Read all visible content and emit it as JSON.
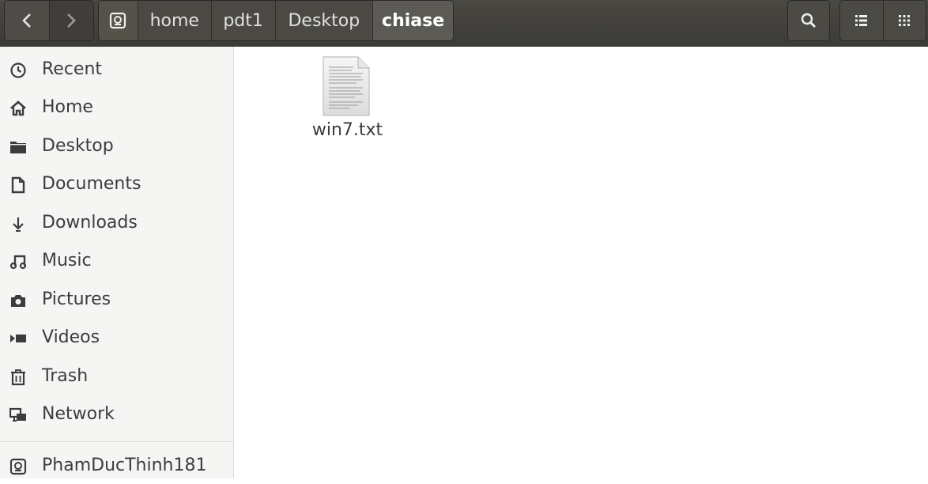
{
  "header": {
    "breadcrumbs": [
      "home",
      "pdt1",
      "Desktop",
      "chiase"
    ],
    "current": "chiase"
  },
  "sidebar": {
    "items": [
      {
        "label": "Recent",
        "icon": "clock-icon"
      },
      {
        "label": "Home",
        "icon": "home-icon"
      },
      {
        "label": "Desktop",
        "icon": "folder-icon"
      },
      {
        "label": "Documents",
        "icon": "document-icon"
      },
      {
        "label": "Downloads",
        "icon": "download-icon"
      },
      {
        "label": "Music",
        "icon": "music-icon"
      },
      {
        "label": "Pictures",
        "icon": "camera-icon"
      },
      {
        "label": "Videos",
        "icon": "video-icon"
      },
      {
        "label": "Trash",
        "icon": "trash-icon"
      },
      {
        "label": "Network",
        "icon": "network-icon"
      }
    ],
    "drives": [
      {
        "label": "PhamDucThinh181",
        "icon": "drive-icon"
      }
    ]
  },
  "main": {
    "files": [
      {
        "name": "win7.txt",
        "icon": "text-file-icon"
      }
    ]
  },
  "colors": {
    "headerbar": "#3c3b37",
    "sidebar": "#f5f5f4",
    "text": "#3c3c3c"
  }
}
